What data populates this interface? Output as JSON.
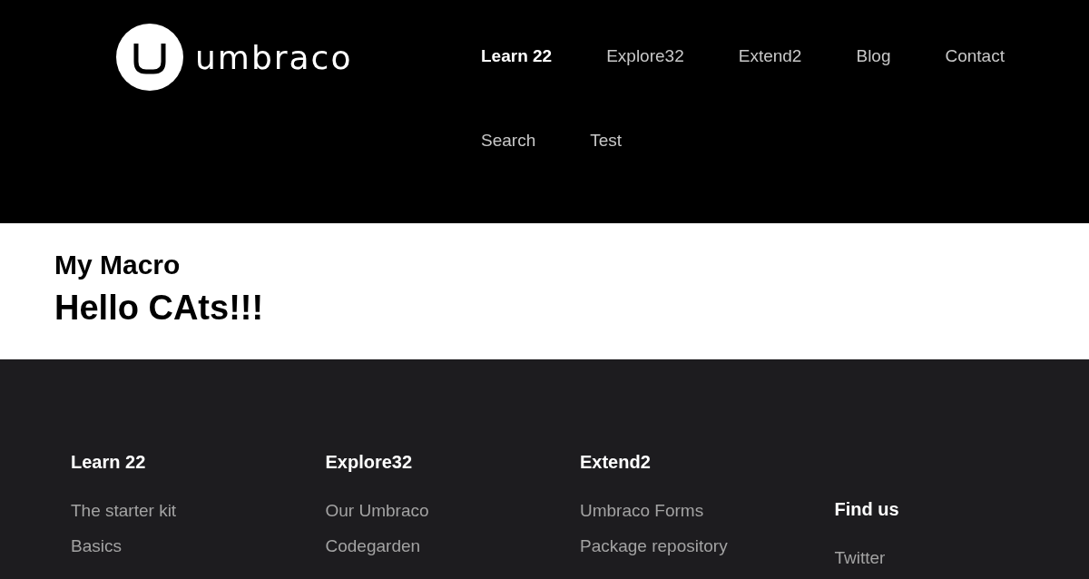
{
  "header": {
    "logo_text": "umbraco",
    "nav": [
      {
        "label": "Learn 22",
        "selected": true
      },
      {
        "label": "Explore32",
        "selected": false
      },
      {
        "label": "Extend2",
        "selected": false
      },
      {
        "label": "Blog",
        "selected": false
      },
      {
        "label": "Contact",
        "selected": false
      },
      {
        "label": "Search",
        "selected": false
      },
      {
        "label": "Test",
        "selected": false
      }
    ]
  },
  "content": {
    "subtitle": "My Macro",
    "title": "Hello CAts!!!"
  },
  "footer": {
    "columns": [
      {
        "heading": "Learn 22",
        "links": [
          "The starter kit",
          "Basics"
        ]
      },
      {
        "heading": "Explore32",
        "links": [
          "Our Umbraco",
          "Codegarden"
        ]
      },
      {
        "heading": "Extend2",
        "links": [
          "Umbraco Forms",
          "Package repository"
        ]
      },
      {
        "heading": "Find us",
        "links": [
          "Twitter"
        ]
      }
    ]
  }
}
